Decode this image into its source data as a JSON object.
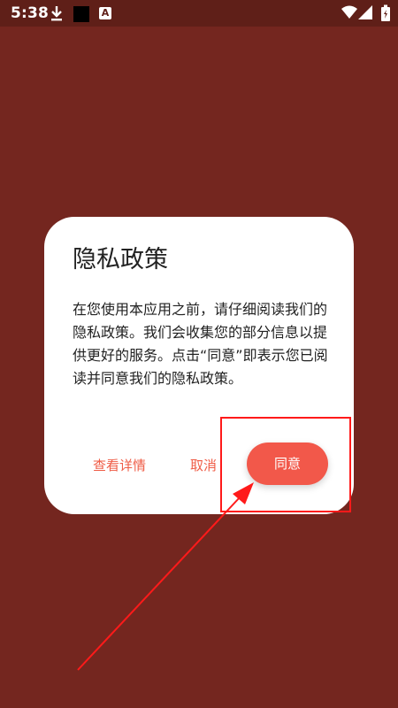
{
  "status_bar": {
    "time": "5:38",
    "icons": [
      "download-icon",
      "black-square-icon",
      "a-icon",
      "wifi-icon",
      "signal-icon",
      "battery-icon"
    ],
    "a_icon_text": "A"
  },
  "dialog": {
    "title": "隐私政策",
    "body": "在您使用本应用之前，请仔细阅读我们的隐私政策。我们会收集您的部分信息以提供更好的服务。点击“同意”即表示您已阅读并同意我们的隐私政策。",
    "view_details_label": "查看详情",
    "cancel_label": "取消",
    "agree_label": "同意"
  },
  "colors": {
    "background": "#74261f",
    "accent": "#f2584a",
    "annotation": "#ff1a1a"
  }
}
